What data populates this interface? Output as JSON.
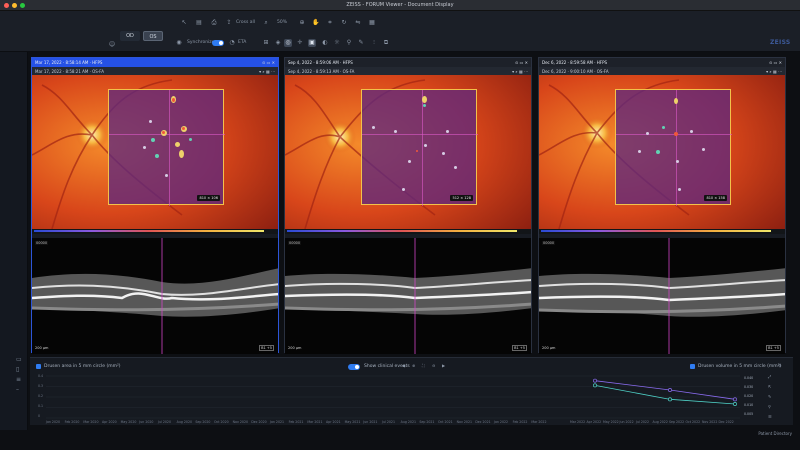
{
  "window": {
    "title": "ZEISS - FORUM Viewer - Document Display"
  },
  "toolbar": {
    "eye_od": "OD",
    "eye_os": "OS",
    "synchronize_label": "Synchronize",
    "eta_label": "ETA",
    "zoom_label": "Cross all",
    "zoom_value": "50%"
  },
  "brand": {
    "logo": "ZEISS"
  },
  "viewers": [
    {
      "date": "Mar 17, 2022 · 8:58:14 AM · HFPS",
      "subtitle": "Mar 17, 2022 · 8:58:21 AM · OS-FA",
      "scale_badge": "810 × 106",
      "oct_label": "00000",
      "oct_scale": "200 µm",
      "oct_ctrl": "B1 +5"
    },
    {
      "date": "Sep 4, 2022 · 8:59:06 AM · HFPS",
      "subtitle": "Sep 4, 2022 · 8:59:13 AM · OS-FA",
      "scale_badge": "512 × 128",
      "oct_label": "00000",
      "oct_scale": "200 µm",
      "oct_ctrl": "B1 +5"
    },
    {
      "date": "Dec 6, 2022 · 8:59:58 AM · HFPS",
      "subtitle": "Dec 6, 2022 · 9:00:10 AM · OS-FA",
      "scale_badge": "810 × 158",
      "oct_label": "00000",
      "oct_scale": "200 µm",
      "oct_ctrl": "B1 +5"
    }
  ],
  "bottom": {
    "left_metric": "Drusen area in 5 mm circle (mm²)",
    "show_clinical": "Show clinical events",
    "right_metric": "Drusen volume in 5 mm circle (mm³)",
    "x_labels": [
      "Jan 2020",
      "Feb 2020",
      "Mar 2020",
      "Apr 2020",
      "May 2020",
      "Jun 2020",
      "Jul 2020",
      "Aug 2020",
      "Sep 2020",
      "Oct 2020",
      "Nov 2020",
      "Dec 2020",
      "Jan 2021",
      "Feb 2021",
      "Mar 2021",
      "Apr 2021",
      "May 2021",
      "Jun 2021",
      "Jul 2021",
      "Aug 2021",
      "Sep 2021",
      "Oct 2021",
      "Nov 2021",
      "Dec 2021",
      "Jan 2022",
      "Feb 2022",
      "Mar 2022"
    ],
    "right_x_labels": [
      "Mar 2022",
      "Apr 2022",
      "May 2022",
      "Jun 2022",
      "Jul 2022",
      "Aug 2022",
      "Sep 2022",
      "Oct 2022",
      "Nov 2022",
      "Dec 2022"
    ],
    "y_labels": [
      "0.4",
      "0.3",
      "0.2",
      "0.1",
      "0"
    ],
    "right_values": [
      "0.040",
      "0.030",
      "0.020",
      "0.010",
      "0.005"
    ]
  },
  "status": {
    "patient_directory": "Patient Directory"
  },
  "chart_data": {
    "type": "line",
    "x": [
      "Mar 2022",
      "Sep 2022",
      "Dec 2022"
    ],
    "series": [
      {
        "values": [
          0.04,
          0.03,
          0.02
        ]
      },
      {
        "values": [
          0.035,
          0.02,
          0.015
        ]
      }
    ],
    "colors": [
      "#8a6cf0",
      "#4fd2c8"
    ]
  }
}
